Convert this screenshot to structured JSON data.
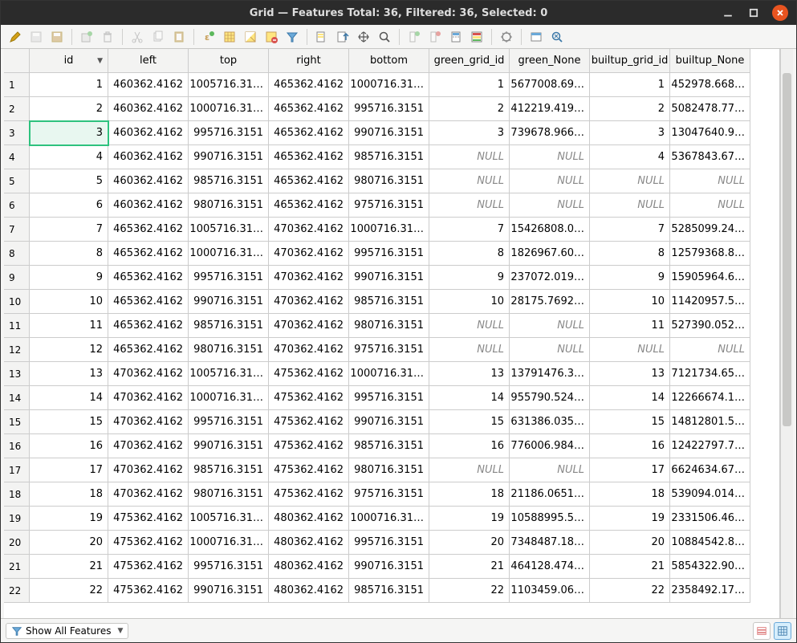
{
  "window": {
    "title": "Grid — Features Total: 36, Filtered: 36, Selected: 0"
  },
  "toolbar": {
    "icons": [
      "pencil-icon",
      "save-edits-icon",
      "save-icon",
      "sep",
      "add-feature-icon",
      "delete-icon",
      "sep",
      "cut-icon",
      "copy-icon",
      "paste-icon",
      "sep",
      "expression-add-icon",
      "select-all-icon",
      "invert-selection-icon",
      "deselect-icon",
      "filter-icon",
      "sep",
      "select-value-icon",
      "move-top-icon",
      "pan-to-icon",
      "zoom-to-icon",
      "sep",
      "new-field-icon",
      "delete-field-icon",
      "field-calc-icon",
      "conditional-format-icon",
      "sep",
      "actions-icon",
      "sep",
      "dock-icon",
      "refresh-icon"
    ]
  },
  "table": {
    "columns": [
      "id",
      "left",
      "top",
      "right",
      "bottom",
      "green_grid_id",
      "green_None",
      "builtup_grid_id",
      "builtup_None"
    ],
    "sort_column": "id",
    "selected_cell": {
      "row": 2,
      "col": 0
    },
    "rows": [
      {
        "n": "1",
        "id": "1",
        "left": "460362.4162",
        "top": "1005716.31…",
        "right": "465362.4162",
        "bottom": "1000716.31…",
        "green_grid_id": "1",
        "green_None": "5677008.69…",
        "builtup_grid_id": "1",
        "builtup_None": "452978.668…"
      },
      {
        "n": "2",
        "id": "2",
        "left": "460362.4162",
        "top": "1000716.31…",
        "right": "465362.4162",
        "bottom": "995716.3151",
        "green_grid_id": "2",
        "green_None": "412219.419…",
        "builtup_grid_id": "2",
        "builtup_None": "5082478.77…"
      },
      {
        "n": "3",
        "id": "3",
        "left": "460362.4162",
        "top": "995716.3151",
        "right": "465362.4162",
        "bottom": "990716.3151",
        "green_grid_id": "3",
        "green_None": "739678.966…",
        "builtup_grid_id": "3",
        "builtup_None": "13047640.9…"
      },
      {
        "n": "4",
        "id": "4",
        "left": "460362.4162",
        "top": "990716.3151",
        "right": "465362.4162",
        "bottom": "985716.3151",
        "green_grid_id": "NULL",
        "green_None": "NULL",
        "builtup_grid_id": "4",
        "builtup_None": "5367843.67…"
      },
      {
        "n": "5",
        "id": "5",
        "left": "460362.4162",
        "top": "985716.3151",
        "right": "465362.4162",
        "bottom": "980716.3151",
        "green_grid_id": "NULL",
        "green_None": "NULL",
        "builtup_grid_id": "NULL",
        "builtup_None": "NULL"
      },
      {
        "n": "6",
        "id": "6",
        "left": "460362.4162",
        "top": "980716.3151",
        "right": "465362.4162",
        "bottom": "975716.3151",
        "green_grid_id": "NULL",
        "green_None": "NULL",
        "builtup_grid_id": "NULL",
        "builtup_None": "NULL"
      },
      {
        "n": "7",
        "id": "7",
        "left": "465362.4162",
        "top": "1005716.31…",
        "right": "470362.4162",
        "bottom": "1000716.31…",
        "green_grid_id": "7",
        "green_None": "15426808.0…",
        "builtup_grid_id": "7",
        "builtup_None": "5285099.24…"
      },
      {
        "n": "8",
        "id": "8",
        "left": "465362.4162",
        "top": "1000716.31…",
        "right": "470362.4162",
        "bottom": "995716.3151",
        "green_grid_id": "8",
        "green_None": "1826967.60…",
        "builtup_grid_id": "8",
        "builtup_None": "12579368.8…"
      },
      {
        "n": "9",
        "id": "9",
        "left": "465362.4162",
        "top": "995716.3151",
        "right": "470362.4162",
        "bottom": "990716.3151",
        "green_grid_id": "9",
        "green_None": "237072.019…",
        "builtup_grid_id": "9",
        "builtup_None": "15905964.6…"
      },
      {
        "n": "10",
        "id": "10",
        "left": "465362.4162",
        "top": "990716.3151",
        "right": "470362.4162",
        "bottom": "985716.3151",
        "green_grid_id": "10",
        "green_None": "28175.7692…",
        "builtup_grid_id": "10",
        "builtup_None": "11420957.5…"
      },
      {
        "n": "11",
        "id": "11",
        "left": "465362.4162",
        "top": "985716.3151",
        "right": "470362.4162",
        "bottom": "980716.3151",
        "green_grid_id": "NULL",
        "green_None": "NULL",
        "builtup_grid_id": "11",
        "builtup_None": "527390.052…"
      },
      {
        "n": "12",
        "id": "12",
        "left": "465362.4162",
        "top": "980716.3151",
        "right": "470362.4162",
        "bottom": "975716.3151",
        "green_grid_id": "NULL",
        "green_None": "NULL",
        "builtup_grid_id": "NULL",
        "builtup_None": "NULL"
      },
      {
        "n": "13",
        "id": "13",
        "left": "470362.4162",
        "top": "1005716.31…",
        "right": "475362.4162",
        "bottom": "1000716.31…",
        "green_grid_id": "13",
        "green_None": "13791476.3…",
        "builtup_grid_id": "13",
        "builtup_None": "7121734.65…"
      },
      {
        "n": "14",
        "id": "14",
        "left": "470362.4162",
        "top": "1000716.31…",
        "right": "475362.4162",
        "bottom": "995716.3151",
        "green_grid_id": "14",
        "green_None": "955790.524…",
        "builtup_grid_id": "14",
        "builtup_None": "12266674.1…"
      },
      {
        "n": "15",
        "id": "15",
        "left": "470362.4162",
        "top": "995716.3151",
        "right": "475362.4162",
        "bottom": "990716.3151",
        "green_grid_id": "15",
        "green_None": "631386.035…",
        "builtup_grid_id": "15",
        "builtup_None": "14812801.5…"
      },
      {
        "n": "16",
        "id": "16",
        "left": "470362.4162",
        "top": "990716.3151",
        "right": "475362.4162",
        "bottom": "985716.3151",
        "green_grid_id": "16",
        "green_None": "776006.984…",
        "builtup_grid_id": "16",
        "builtup_None": "12422797.7…"
      },
      {
        "n": "17",
        "id": "17",
        "left": "470362.4162",
        "top": "985716.3151",
        "right": "475362.4162",
        "bottom": "980716.3151",
        "green_grid_id": "NULL",
        "green_None": "NULL",
        "builtup_grid_id": "17",
        "builtup_None": "6624634.67…"
      },
      {
        "n": "18",
        "id": "18",
        "left": "470362.4162",
        "top": "980716.3151",
        "right": "475362.4162",
        "bottom": "975716.3151",
        "green_grid_id": "18",
        "green_None": "21186.0651…",
        "builtup_grid_id": "18",
        "builtup_None": "539094.014…"
      },
      {
        "n": "19",
        "id": "19",
        "left": "475362.4162",
        "top": "1005716.31…",
        "right": "480362.4162",
        "bottom": "1000716.31…",
        "green_grid_id": "19",
        "green_None": "10588995.5…",
        "builtup_grid_id": "19",
        "builtup_None": "2331506.46…"
      },
      {
        "n": "20",
        "id": "20",
        "left": "475362.4162",
        "top": "1000716.31…",
        "right": "480362.4162",
        "bottom": "995716.3151",
        "green_grid_id": "20",
        "green_None": "7348487.18…",
        "builtup_grid_id": "20",
        "builtup_None": "10884542.8…"
      },
      {
        "n": "21",
        "id": "21",
        "left": "475362.4162",
        "top": "995716.3151",
        "right": "480362.4162",
        "bottom": "990716.3151",
        "green_grid_id": "21",
        "green_None": "464128.474…",
        "builtup_grid_id": "21",
        "builtup_None": "5854322.90…"
      },
      {
        "n": "22",
        "id": "22",
        "left": "475362.4162",
        "top": "990716.3151",
        "right": "480362.4162",
        "bottom": "985716.3151",
        "green_grid_id": "22",
        "green_None": "1103459.06…",
        "builtup_grid_id": "22",
        "builtup_None": "2358492.17…"
      }
    ]
  },
  "footer": {
    "filter_label": "Show All Features"
  }
}
